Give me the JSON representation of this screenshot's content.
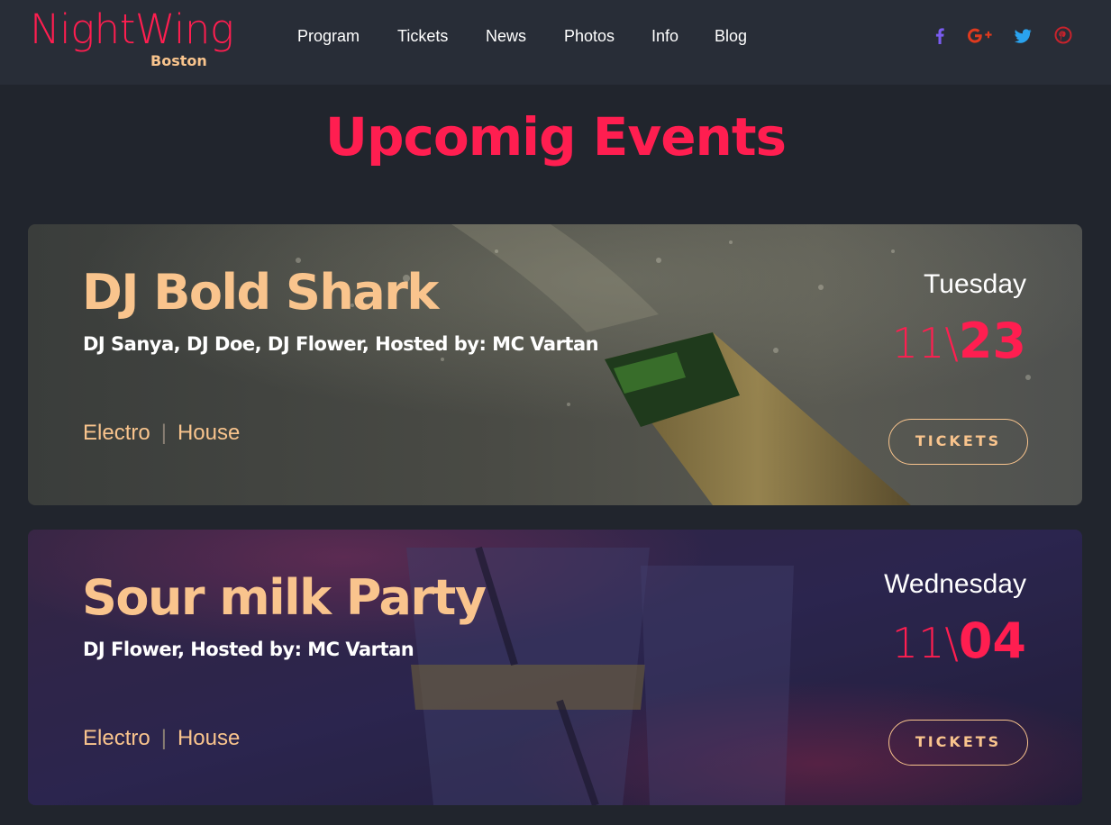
{
  "brand": {
    "name": "NightWing",
    "city": "Boston"
  },
  "nav": [
    {
      "label": "Program"
    },
    {
      "label": "Tickets"
    },
    {
      "label": "News"
    },
    {
      "label": "Photos"
    },
    {
      "label": "Info"
    },
    {
      "label": "Blog"
    }
  ],
  "social": [
    {
      "icon": "facebook-icon",
      "color": "#7a5cf0"
    },
    {
      "icon": "google-plus-icon",
      "color": "#e03a1e"
    },
    {
      "icon": "twitter-icon",
      "color": "#2aa3ef"
    },
    {
      "icon": "pinterest-icon",
      "color": "#c8232c"
    }
  ],
  "headline": "Upcomig Events",
  "events": [
    {
      "title": "DJ Bold Shark",
      "lineup": "DJ Sanya, DJ Doe, DJ Flower, Hosted by: MC Vartan",
      "genres": [
        "Electro",
        "House"
      ],
      "genre_separator": "|",
      "weekday": "Tuesday",
      "month": "11",
      "date_separator": "\\",
      "day": "23",
      "tickets_label": "TICKETS"
    },
    {
      "title": "Sour milk Party",
      "lineup": "DJ Flower, Hosted by: MC Vartan",
      "genres": [
        "Electro",
        "House"
      ],
      "genre_separator": "|",
      "weekday": "Wednesday",
      "month": "11",
      "date_separator": "\\",
      "day": "04",
      "tickets_label": "TICKETS"
    }
  ],
  "colors": {
    "accent": "#ff1e50",
    "gold": "#f9c48d",
    "page_bg": "#21252d",
    "header_bg": "#282d37"
  }
}
